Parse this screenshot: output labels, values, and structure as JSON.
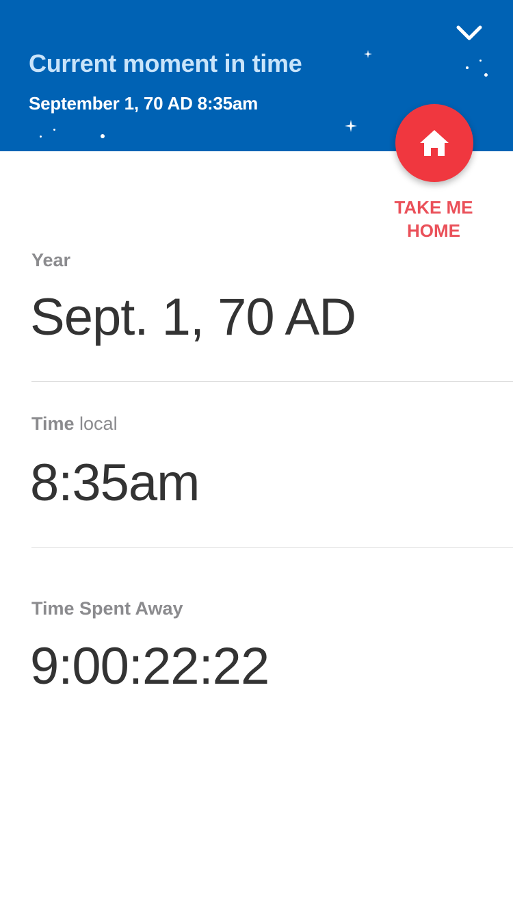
{
  "header": {
    "title": "Current moment in time",
    "subtitle": "September 1, 70 AD 8:35am",
    "collapse_icon": "chevron-down-icon",
    "background_color": "#0062b4"
  },
  "home_button": {
    "icon": "home-icon",
    "label_line1": "TAKE ME",
    "label_line2": "HOME",
    "color": "#f0373f"
  },
  "sections": {
    "year": {
      "label": "Year",
      "value": "Sept. 1, 70 AD"
    },
    "time_local": {
      "label_bold": "Time",
      "label_light": "local",
      "value": "8:35am"
    },
    "time_away": {
      "label": "Time Spent Away",
      "value": "9:00:22:22"
    }
  }
}
